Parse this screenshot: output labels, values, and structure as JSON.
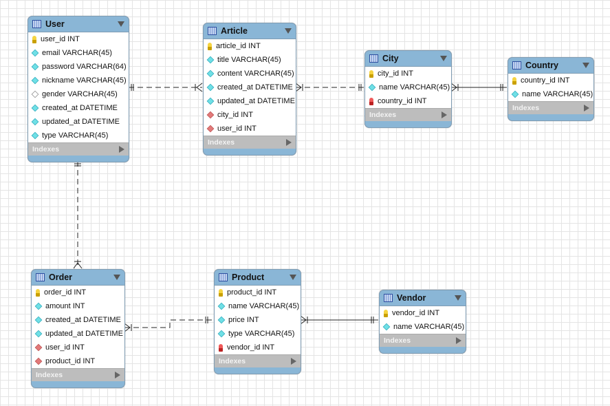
{
  "tables": [
    {
      "name": "User",
      "icon": "table-icon",
      "columns": [
        {
          "label": "user_id INT",
          "icon": "pk"
        },
        {
          "label": "email VARCHAR(45)",
          "icon": "col"
        },
        {
          "label": "password VARCHAR(64)",
          "icon": "col"
        },
        {
          "label": "nickname VARCHAR(45)",
          "icon": "col"
        },
        {
          "label": "gender VARCHAR(45)",
          "icon": "nullable"
        },
        {
          "label": "created_at DATETIME",
          "icon": "col"
        },
        {
          "label": "updated_at DATETIME",
          "icon": "col"
        },
        {
          "label": "type VARCHAR(45)",
          "icon": "col"
        }
      ],
      "indexes_label": "Indexes"
    },
    {
      "name": "Article",
      "icon": "table-icon",
      "columns": [
        {
          "label": "article_id INT",
          "icon": "pk"
        },
        {
          "label": "title VARCHAR(45)",
          "icon": "col"
        },
        {
          "label": "content VARCHAR(45)",
          "icon": "col"
        },
        {
          "label": "created_at DATETIME",
          "icon": "col"
        },
        {
          "label": "updated_at DATETIME",
          "icon": "col"
        },
        {
          "label": "city_id INT",
          "icon": "fk"
        },
        {
          "label": "user_id INT",
          "icon": "fk"
        }
      ],
      "indexes_label": "Indexes"
    },
    {
      "name": "City",
      "icon": "table-icon",
      "columns": [
        {
          "label": "city_id INT",
          "icon": "pk"
        },
        {
          "label": "name VARCHAR(45)",
          "icon": "col"
        },
        {
          "label": "country_id INT",
          "icon": "fkkey"
        }
      ],
      "indexes_label": "Indexes"
    },
    {
      "name": "Country",
      "icon": "table-icon",
      "columns": [
        {
          "label": "country_id INT",
          "icon": "pk"
        },
        {
          "label": "name VARCHAR(45)",
          "icon": "col"
        }
      ],
      "indexes_label": "Indexes"
    },
    {
      "name": "Order",
      "icon": "table-icon",
      "columns": [
        {
          "label": "order_id INT",
          "icon": "pk"
        },
        {
          "label": "amount INT",
          "icon": "col"
        },
        {
          "label": "created_at DATETIME",
          "icon": "col"
        },
        {
          "label": "updated_at DATETIME",
          "icon": "col"
        },
        {
          "label": "user_id INT",
          "icon": "fk"
        },
        {
          "label": "product_id INT",
          "icon": "fk"
        }
      ],
      "indexes_label": "Indexes"
    },
    {
      "name": "Product",
      "icon": "table-icon",
      "columns": [
        {
          "label": "product_id INT",
          "icon": "pk"
        },
        {
          "label": "name VARCHAR(45)",
          "icon": "col"
        },
        {
          "label": "price INT",
          "icon": "col"
        },
        {
          "label": "type VARCHAR(45)",
          "icon": "col"
        },
        {
          "label": "vendor_id INT",
          "icon": "fkkey"
        }
      ],
      "indexes_label": "Indexes"
    },
    {
      "name": "Vendor",
      "icon": "table-icon",
      "columns": [
        {
          "label": "vendor_id INT",
          "icon": "pk"
        },
        {
          "label": "name VARCHAR(45)",
          "icon": "col"
        }
      ],
      "indexes_label": "Indexes"
    }
  ],
  "relationships": [
    {
      "from": "User",
      "to": "Article",
      "style": "non-identifying",
      "cardinality": "one-to-many"
    },
    {
      "from": "City",
      "to": "Article",
      "style": "non-identifying",
      "cardinality": "one-to-many"
    },
    {
      "from": "Country",
      "to": "City",
      "style": "identifying",
      "cardinality": "one-to-many"
    },
    {
      "from": "User",
      "to": "Order",
      "style": "non-identifying",
      "cardinality": "one-to-many"
    },
    {
      "from": "Product",
      "to": "Order",
      "style": "non-identifying",
      "cardinality": "one-to-many"
    },
    {
      "from": "Vendor",
      "to": "Product",
      "style": "identifying",
      "cardinality": "one-to-many"
    }
  ],
  "colors": {
    "header": "#8ab6d6",
    "indexes": "#bdbdbd",
    "pk": "#f5d442",
    "fk": "#e27a7a",
    "column": "#6fe0e6"
  }
}
